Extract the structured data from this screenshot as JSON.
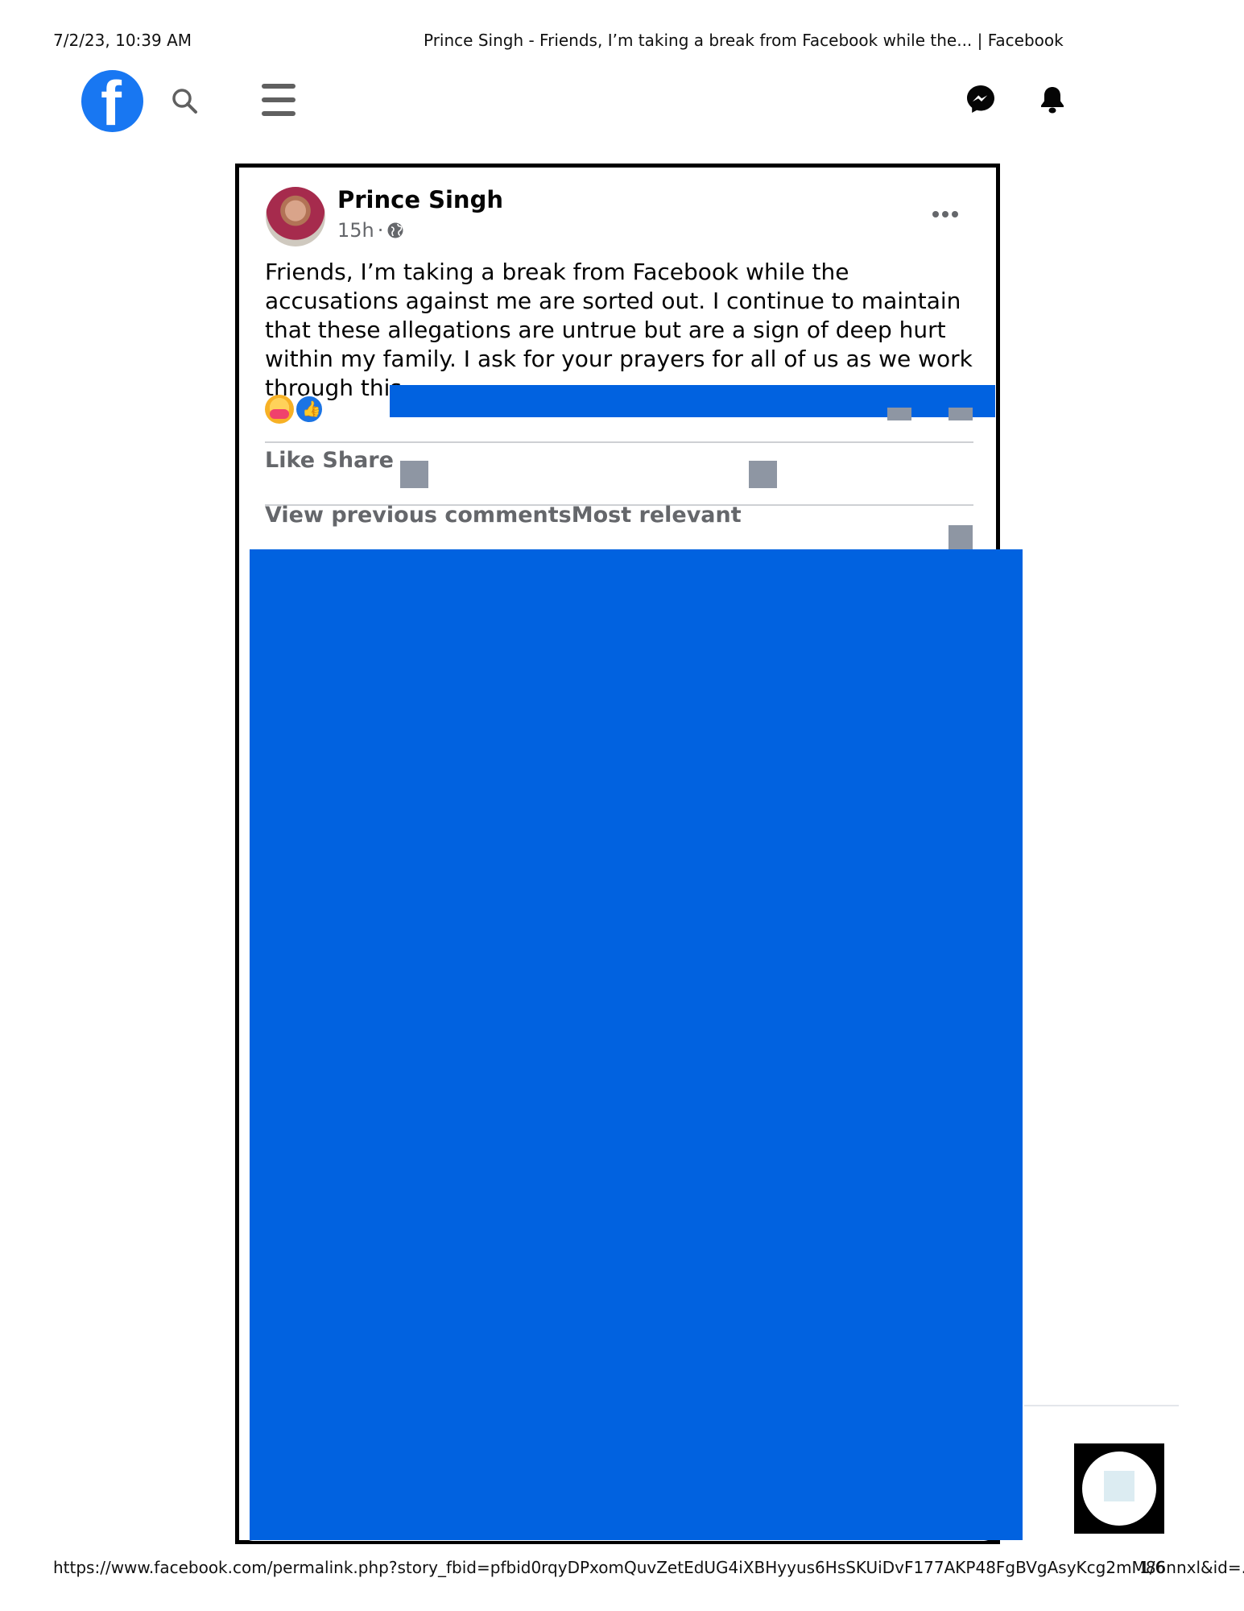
{
  "print_header": {
    "datetime": "7/2/23, 10:39 AM",
    "title": "Prince Singh - Friends, I’m taking a break from Facebook while the... | Facebook"
  },
  "print_footer": {
    "url": "https://www.facebook.com/permalink.php?story_fbid=pfbid0rqyDPxomQuvZetEdUG4iXBHyyus6HsSKUiDvF177AKP48FgBVgAsyKcg2mM86nnxl&id=...",
    "page": "1/6"
  },
  "top_bar": {
    "logo_glyph": "f",
    "icons": [
      "facebook-logo",
      "search-icon",
      "menu-icon",
      "messenger-icon",
      "notifications-bell-icon"
    ]
  },
  "post": {
    "author": "Prince Singh",
    "time": "15h",
    "separator": "·",
    "audience_icon": "globe-icon",
    "text": "Friends, I’m taking a break from Facebook while the accusations against me are sorted out. I continue to maintain that these allegations are untrue but are a sign of deep hurt within my family. I ask for your prayers for all of us as we work through this.",
    "reactions": [
      "care",
      "like"
    ],
    "actions_label": "Like Share",
    "comments_label": "View previous commentsMost relevant"
  },
  "colors": {
    "facebook_blue": "#1877f2",
    "redaction_blue": "#0162e0",
    "secondary_text": "#65676b",
    "placeholder_gray": "#8e96a3"
  }
}
